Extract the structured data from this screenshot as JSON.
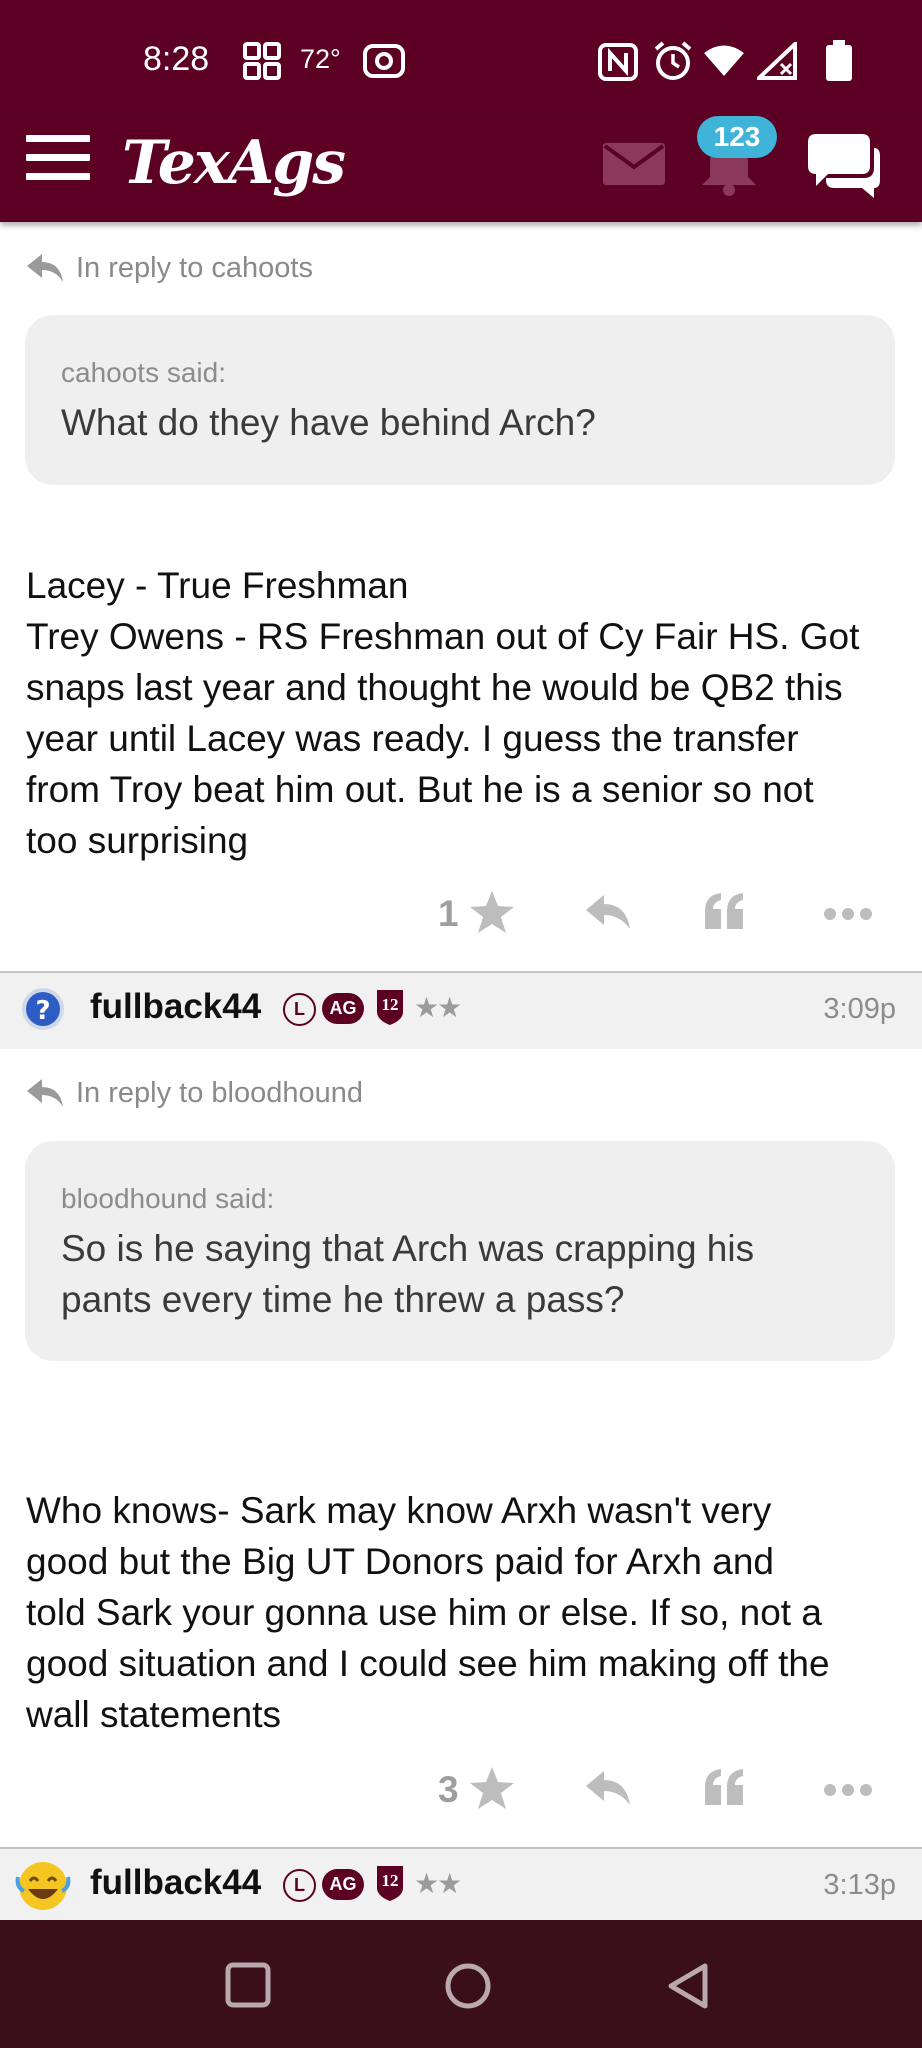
{
  "status_bar": {
    "time": "8:28",
    "temperature": "72°"
  },
  "header": {
    "logo": "TexAgs",
    "notification_count": "123",
    "colors": {
      "brand": "#5c0024",
      "badge": "#3fb3d8"
    }
  },
  "posts": [
    {
      "reply_to": "In reply to cahoots",
      "quote_author": "cahoots said:",
      "quote_text": "What do they have behind Arch?",
      "body_lines": [
        "Lacey - True Freshman",
        "Trey Owens - RS Freshman out of Cy Fair HS. Got",
        "snaps last year and thought he would be QB2 this",
        "year until Lacey was ready. I guess the transfer",
        "from Troy beat him out. But he is a senior so not",
        "too surprising"
      ],
      "star_count": "1"
    },
    {
      "author": "fullback44",
      "time": "3:09p",
      "badges": {
        "l": "L",
        "ag": "AG",
        "twelve": "12",
        "stars": "★★"
      },
      "reply_to": "In reply to bloodhound",
      "quote_author": "bloodhound said:",
      "quote_lines": [
        "So is he saying that Arch was crapping his",
        "pants every time he threw a pass?"
      ],
      "body_lines": [
        "Who knows- Sark may know Arxh wasn't very",
        "good but the Big UT Donors paid for Arxh and",
        "told Sark your gonna use him or else. If so, not a",
        "good situation and I could see him making off the",
        "wall statements"
      ],
      "star_count": "3"
    },
    {
      "author": "fullback44",
      "time": "3:13p",
      "badges": {
        "l": "L",
        "ag": "AG",
        "twelve": "12",
        "stars": "★★"
      }
    }
  ]
}
